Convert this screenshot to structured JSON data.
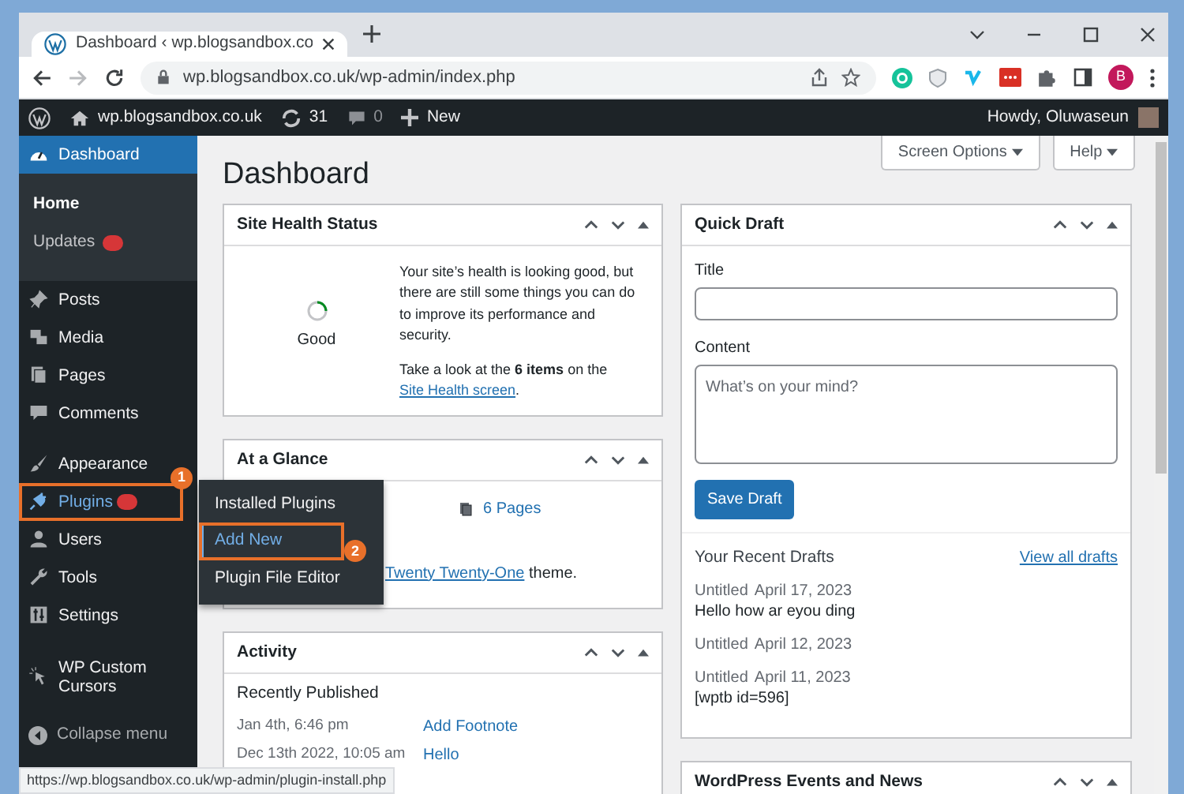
{
  "browser": {
    "tab_title": "Dashboard ‹ wp.blogsandbox.co",
    "url": "wp.blogsandbox.co.uk/wp-admin/index.php",
    "profile_initial": "B",
    "status_url": "https://wp.blogsandbox.co.uk/wp-admin/plugin-install.php"
  },
  "admin_bar": {
    "site": "wp.blogsandbox.co.uk",
    "updates": "31",
    "comments": "0",
    "new": "New",
    "greeting": "Howdy, Oluwaseun"
  },
  "sidebar": {
    "groups": [
      {
        "items": [
          {
            "label": "Dashboard",
            "selected": true,
            "open": false,
            "badge": false,
            "submenu": [
              {
                "label": "Home",
                "selected": true,
                "badge": false
              },
              {
                "label": "Updates",
                "selected": false,
                "badge": true
              }
            ]
          },
          {
            "label": "Posts",
            "selected": false,
            "open": false,
            "badge": false
          },
          {
            "label": "Media",
            "selected": false,
            "open": false,
            "badge": false
          },
          {
            "label": "Pages",
            "selected": false,
            "open": false,
            "badge": false
          },
          {
            "label": "Comments",
            "selected": false,
            "open": false,
            "badge": false
          }
        ]
      },
      {
        "items": [
          {
            "label": "Appearance",
            "selected": false,
            "open": false,
            "badge": false
          },
          {
            "label": "Plugins",
            "selected": false,
            "open": true,
            "badge": true,
            "callout": "1",
            "flyout": [
              {
                "label": "Installed Plugins",
                "selected": false
              },
              {
                "label": "Add New",
                "selected": true,
                "callout": "2"
              },
              {
                "label": "Plugin File Editor",
                "selected": false
              }
            ]
          },
          {
            "label": "Users",
            "selected": false,
            "open": false,
            "badge": false
          },
          {
            "label": "Tools",
            "selected": false,
            "open": false,
            "badge": false
          },
          {
            "label": "Settings",
            "selected": false,
            "open": false,
            "badge": false
          }
        ]
      },
      {
        "items": [
          {
            "label": "WP Custom Cursors",
            "selected": false,
            "open": false,
            "badge": false
          }
        ]
      }
    ],
    "collapse": "Collapse menu"
  },
  "header": {
    "title": "Dashboard",
    "buttons": [
      {
        "label": "Screen Options"
      },
      {
        "label": "Help"
      }
    ]
  },
  "columns": [
    {
      "widgets": [
        {
          "kind": "site_health",
          "title": "Site Health Status",
          "status": "Good",
          "summary": "Your site’s health is looking good, but there are still some things you can do to improve its performance and security.",
          "cta_before": "Take a look at the **6 items** on the ",
          "cta_link": "Site Health screen",
          "cta_after": "."
        },
        {
          "kind": "glance",
          "title": "At a Glance",
          "pages": "6 Pages",
          "theme_link": "Twenty Twenty-One",
          "theme_after": " theme."
        },
        {
          "kind": "activity",
          "title": "Activity",
          "subtitle": "Recently Published",
          "rows": [
            {
              "date": "Jan 4th, 6:46 pm",
              "title": "Add Footnote"
            },
            {
              "date": "Dec 13th 2022, 10:05 am",
              "title": "Hello"
            }
          ]
        }
      ]
    },
    {
      "widgets": [
        {
          "kind": "quick_draft",
          "title": "Quick Draft",
          "title_label": "Title",
          "content_label": "Content",
          "content_placeholder": "What’s on your mind?",
          "save": "Save Draft",
          "recent_heading": "Your Recent Drafts",
          "view_all": "View all drafts",
          "drafts": [
            {
              "title": "Untitled",
              "date": "April 17, 2023",
              "excerpt": "Hello how ar eyou ding"
            },
            {
              "title": "Untitled",
              "date": "April 12, 2023"
            },
            {
              "title": "Untitled",
              "date": "April 11, 2023",
              "excerpt": "[wptb id=596]"
            }
          ]
        },
        {
          "kind": "events",
          "title": "WordPress Events and News"
        }
      ]
    }
  ]
}
